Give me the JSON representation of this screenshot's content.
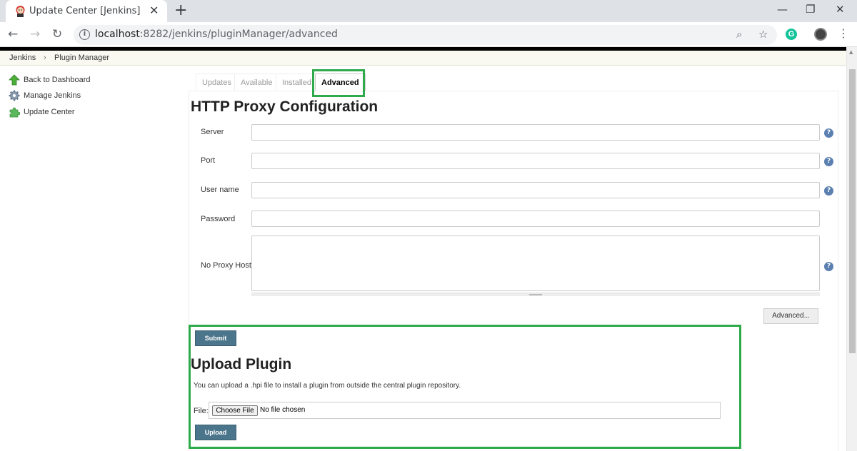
{
  "browser": {
    "tab_title": "Update Center [Jenkins]",
    "tab_close": "✕",
    "new_tab": "+",
    "url_host": "localhost",
    "url_path": ":8282/jenkins/pluginManager/advanced",
    "window_controls": {
      "minimize": "—",
      "maximize": "❐",
      "close": "✕"
    },
    "icons": [
      "back-arrow-icon",
      "forward-arrow-icon",
      "reload-icon",
      "site-info-icon",
      "zoom-icon",
      "bookmark-star-icon",
      "grammarly-icon",
      "profile-avatar",
      "menu-dots-icon"
    ]
  },
  "breadcrumb": {
    "items": [
      "Jenkins",
      "Plugin Manager"
    ],
    "separator": "›"
  },
  "sidebar": {
    "items": [
      {
        "label": "Back to Dashboard",
        "icon": "up-arrow-icon"
      },
      {
        "label": "Manage Jenkins",
        "icon": "gear-icon"
      },
      {
        "label": "Update Center",
        "icon": "puzzle-icon"
      }
    ]
  },
  "plugin_tabs": [
    "Updates",
    "Available",
    "Installed",
    "Advanced"
  ],
  "active_tab": "Advanced",
  "proxy": {
    "heading": "HTTP Proxy Configuration",
    "fields": {
      "server": {
        "label": "Server",
        "value": ""
      },
      "port": {
        "label": "Port",
        "value": ""
      },
      "username": {
        "label": "User name",
        "value": ""
      },
      "password": {
        "label": "Password",
        "value": ""
      },
      "no_proxy_host": {
        "label": "No Proxy Host",
        "value": ""
      }
    },
    "help_glyph": "?",
    "advanced_button": "Advanced...",
    "submit_button": "Submit"
  },
  "upload": {
    "heading": "Upload Plugin",
    "description": "You can upload a .hpi file to install a plugin from outside the central plugin repository.",
    "file_label": "File:",
    "choose_button": "Choose File",
    "no_file_text": "No file chosen",
    "upload_button": "Upload"
  },
  "colors": {
    "highlight": "#2eaa4a",
    "primary_button": "#4b758b",
    "help_icon": "#5a7fb0"
  }
}
